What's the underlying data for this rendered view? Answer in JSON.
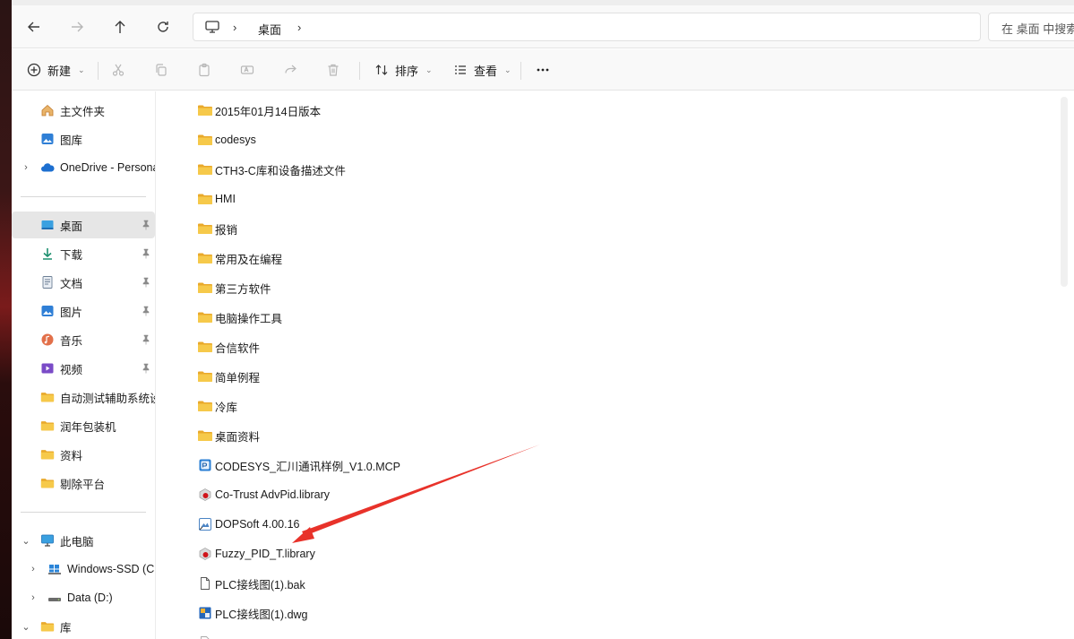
{
  "address": {
    "breadcrumb": "桌面",
    "search_placeholder": "在 桌面 中搜索"
  },
  "toolbar": {
    "new_label": "新建",
    "sort_label": "排序",
    "view_label": "查看"
  },
  "sidebar": {
    "home": "主文件夹",
    "gallery": "图库",
    "onedrive": "OneDrive - Personal",
    "desktop": "桌面",
    "downloads": "下载",
    "documents": "文档",
    "pictures": "图片",
    "music": "音乐",
    "videos": "视频",
    "folder1": "自动测试辅助系统设计",
    "folder2": "润年包装机",
    "folder3": "资料",
    "folder4": "剔除平台",
    "this_pc": "此电脑",
    "drive_c": "Windows-SSD (C:)",
    "drive_d": "Data (D:)",
    "library": "库"
  },
  "files": [
    {
      "name": "2015年01月14日版本",
      "icon": "folder-icon"
    },
    {
      "name": "codesys",
      "icon": "folder-icon"
    },
    {
      "name": "CTH3-C库和设备描述文件",
      "icon": "folder-icon"
    },
    {
      "name": "HMI",
      "icon": "folder-icon"
    },
    {
      "name": "报销",
      "icon": "folder-icon"
    },
    {
      "name": "常用及在编程",
      "icon": "folder-icon"
    },
    {
      "name": "第三方软件",
      "icon": "folder-icon"
    },
    {
      "name": "电脑操作工具",
      "icon": "folder-icon"
    },
    {
      "name": "合信软件",
      "icon": "folder-icon"
    },
    {
      "name": "简单例程",
      "icon": "folder-icon"
    },
    {
      "name": "冷库",
      "icon": "folder-icon"
    },
    {
      "name": "桌面资料",
      "icon": "folder-icon"
    },
    {
      "name": "CODESYS_汇川通讯样例_V1.0.MCP",
      "icon": "codesys-project-icon"
    },
    {
      "name": "Co-Trust AdvPid.library",
      "icon": "library-icon"
    },
    {
      "name": "DOPSoft 4.00.16",
      "icon": "dopsoft-shortcut-icon"
    },
    {
      "name": "Fuzzy_PID_T.library",
      "icon": "library-icon"
    },
    {
      "name": "PLC接线图(1).bak",
      "icon": "file-icon"
    },
    {
      "name": "PLC接线图(1).dwg",
      "icon": "dwg-icon"
    }
  ],
  "colors": {
    "folder": "#f3c542",
    "arrow": "#e8322a",
    "selected": "#e6e6e6"
  }
}
